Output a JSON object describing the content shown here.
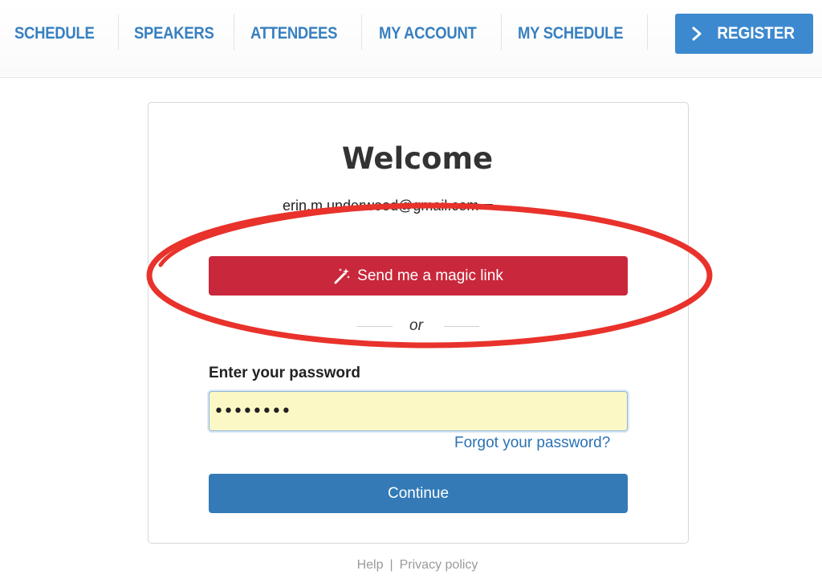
{
  "nav": {
    "items": [
      {
        "label": "SCHEDULE"
      },
      {
        "label": "SPEAKERS"
      },
      {
        "label": "ATTENDEES"
      },
      {
        "label": "MY ACCOUNT"
      },
      {
        "label": "MY SCHEDULE"
      }
    ],
    "register_label": "REGISTER"
  },
  "login": {
    "title": "Welcome",
    "email": "erin.m.underwood@gmail.com",
    "magic_link_label": "Send me a magic link",
    "or_text": "or",
    "password_label": "Enter your password",
    "password_value": "••••••••",
    "forgot_label": "Forgot your password?",
    "continue_label": "Continue"
  },
  "footer": {
    "help_label": "Help",
    "separator": "|",
    "privacy_label": "Privacy policy"
  },
  "colors": {
    "nav_link": "#3780c0",
    "register_bg": "#3d89cf",
    "magic_button_bg": "#c9273b",
    "continue_button_bg": "#337ab7",
    "password_field_bg": "#fbf8c6",
    "annotation_ellipse": "#e8322b"
  },
  "icons": {
    "register": "chevron-right-icon",
    "magic_link": "magic-wand-icon",
    "email_dropdown": "caret-down-icon"
  }
}
